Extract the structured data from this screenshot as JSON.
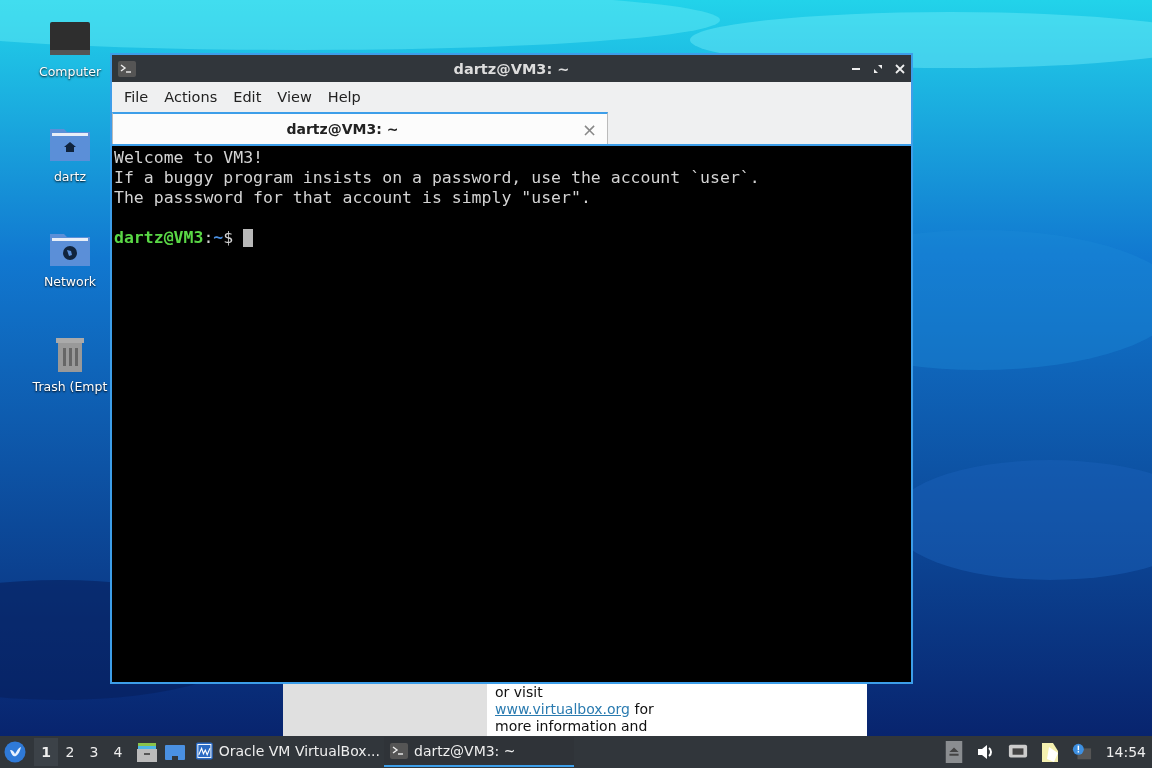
{
  "desktop_icons": [
    {
      "kind": "computer",
      "label": "Computer"
    },
    {
      "kind": "home",
      "label": "dartz"
    },
    {
      "kind": "network",
      "label": "Network"
    },
    {
      "kind": "trash",
      "label": "Trash (Empt"
    }
  ],
  "background_window": {
    "lines": [
      {
        "text": "or visit"
      },
      {
        "link": "www.virtualbox.org",
        "text": " for"
      },
      {
        "text": "more information and"
      }
    ]
  },
  "terminal": {
    "title": "dartz@VM3: ~",
    "menu": [
      "File",
      "Actions",
      "Edit",
      "View",
      "Help"
    ],
    "tabs": [
      {
        "label": "dartz@VM3: ~",
        "selected": true,
        "close": "×"
      }
    ],
    "lines": [
      "Welcome to VM3!",
      "If a buggy program insists on a password, use the account `user`.",
      "The passsword for that account is simply \"user\"."
    ],
    "prompt": {
      "user_host": "dartz@VM3",
      "separator": ":",
      "path": "~",
      "symbol": "$"
    }
  },
  "taskbar": {
    "workspaces": [
      {
        "label": "1",
        "selected": true
      },
      {
        "label": "2",
        "selected": false
      },
      {
        "label": "3",
        "selected": false
      },
      {
        "label": "4",
        "selected": false
      }
    ],
    "tasks": [
      {
        "kind": "virtualbox",
        "label": "Oracle VM VirtualBox...",
        "selected": false
      },
      {
        "kind": "terminal",
        "label": "dartz@VM3: ~",
        "selected": true
      }
    ],
    "clock": "14:54"
  }
}
